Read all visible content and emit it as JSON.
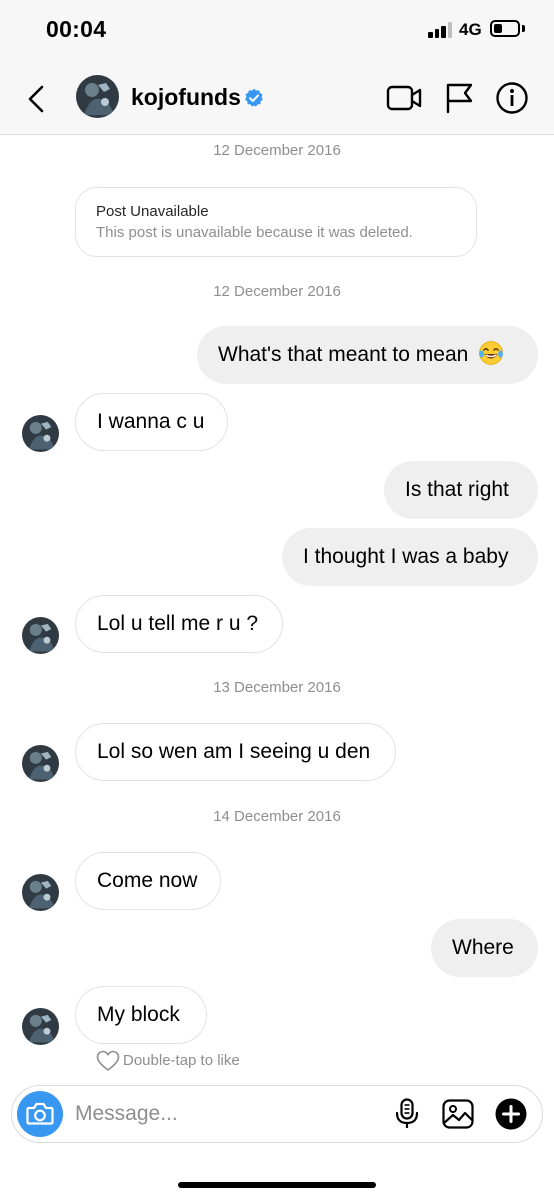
{
  "status_bar": {
    "time": "00:04",
    "network": "4G",
    "signal_bars": 3,
    "battery_level": 0.35
  },
  "header": {
    "username": "kojofunds",
    "verified": true,
    "icons": [
      "back-chevron-icon",
      "verified-badge-icon",
      "video-call-icon",
      "flag-icon",
      "info-icon"
    ]
  },
  "chat": {
    "dates": [
      "12 December 2016",
      "12 December 2016",
      "13 December 2016",
      "14 December 2016"
    ],
    "post": {
      "title": "Post Unavailable",
      "subtitle": "This post is unavailable because it was deleted."
    },
    "messages": [
      {
        "from": "me",
        "text": "What's that meant to mean",
        "emoji": "face-with-tears-of-joy-icon"
      },
      {
        "from": "them",
        "text": "I wanna c u"
      },
      {
        "from": "me",
        "text": "Is that right"
      },
      {
        "from": "me",
        "text": "I thought I was a baby"
      },
      {
        "from": "them",
        "text": "Lol u tell me r u ?"
      },
      {
        "from": "them",
        "text": "Lol so wen am I seeing u den"
      },
      {
        "from": "them",
        "text": "Come now"
      },
      {
        "from": "me",
        "text": "Where"
      },
      {
        "from": "them",
        "text": "My block"
      }
    ],
    "like_hint": "Double-tap to like"
  },
  "composer": {
    "placeholder": "Message...",
    "icons": [
      "camera-icon",
      "microphone-icon",
      "gallery-icon",
      "add-icon"
    ]
  },
  "colors": {
    "accent_blue": "#3897f0",
    "outgoing_bubble": "#efefef",
    "secondary_text": "#8e8e8e"
  }
}
